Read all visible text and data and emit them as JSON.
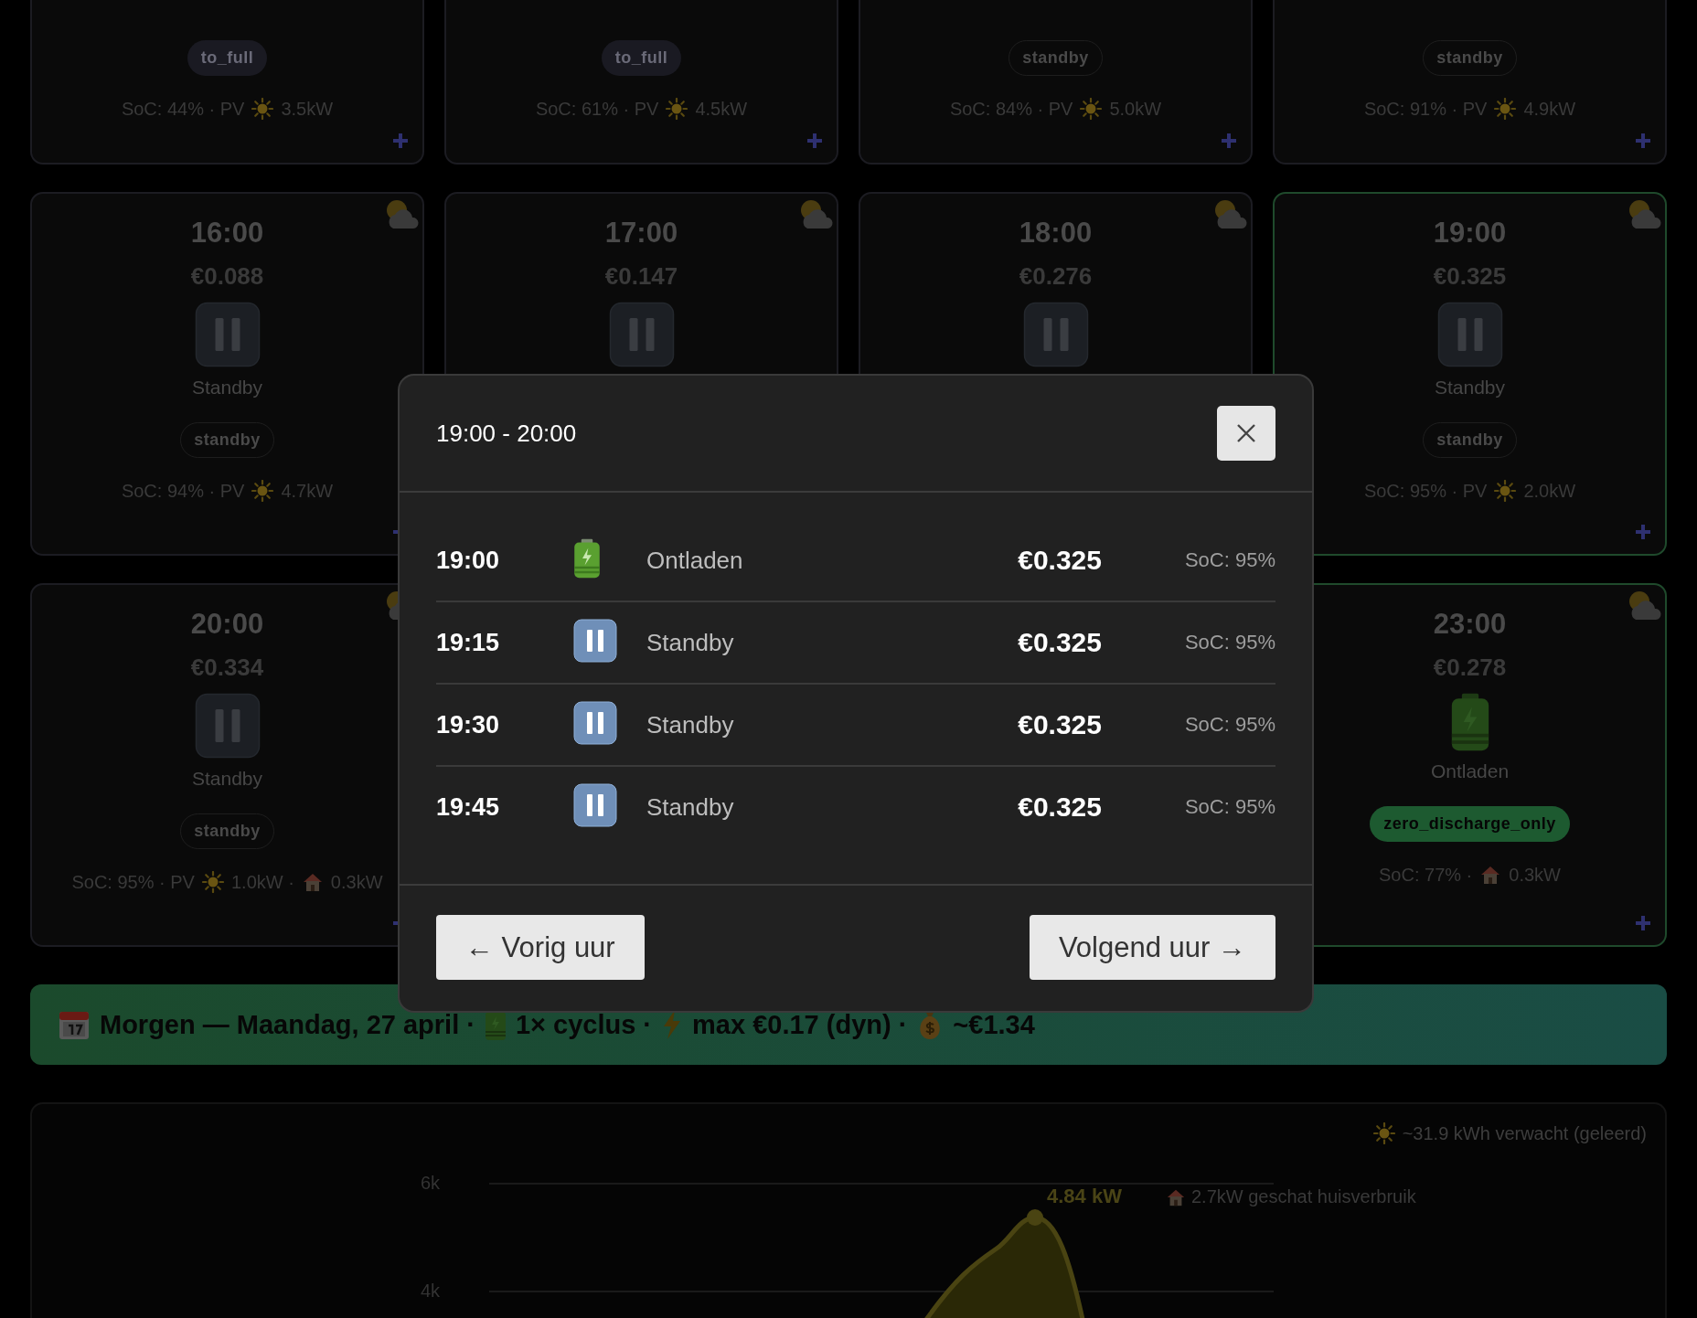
{
  "card_rows": [
    {
      "cards": [
        {
          "highlighted": false,
          "badge": {
            "text": "to_full",
            "kind": "dark"
          },
          "stats": [
            {
              "kind": "text",
              "text": "SoC: 44% · PV"
            },
            {
              "kind": "sun"
            },
            {
              "kind": "text",
              "text": "3.5kW"
            }
          ]
        },
        {
          "highlighted": false,
          "badge": {
            "text": "to_full",
            "kind": "dark"
          },
          "stats": [
            {
              "kind": "text",
              "text": "SoC: 61% · PV"
            },
            {
              "kind": "sun"
            },
            {
              "kind": "text",
              "text": "4.5kW"
            }
          ]
        },
        {
          "highlighted": false,
          "badge": {
            "text": "standby",
            "kind": "outline"
          },
          "stats": [
            {
              "kind": "text",
              "text": "SoC: 84% · PV"
            },
            {
              "kind": "sun"
            },
            {
              "kind": "text",
              "text": "5.0kW"
            }
          ]
        },
        {
          "highlighted": false,
          "badge": {
            "text": "standby",
            "kind": "outline"
          },
          "stats": [
            {
              "kind": "text",
              "text": "SoC: 91% · PV"
            },
            {
              "kind": "sun"
            },
            {
              "kind": "text",
              "text": "4.9kW"
            }
          ]
        }
      ]
    },
    {
      "cards": [
        {
          "time": "16:00",
          "price": "€0.088",
          "kind": "standby",
          "label": "Standby",
          "highlighted": false,
          "badge": {
            "text": "standby",
            "kind": "outline"
          },
          "stats": [
            {
              "kind": "text",
              "text": "SoC: 94% · PV"
            },
            {
              "kind": "sun"
            },
            {
              "kind": "text",
              "text": "4.7kW"
            }
          ]
        },
        {
          "time": "17:00",
          "price": "€0.147",
          "kind": "standby",
          "highlighted": false
        },
        {
          "time": "18:00",
          "price": "€0.276",
          "kind": "standby",
          "highlighted": false
        },
        {
          "time": "19:00",
          "price": "€0.325",
          "kind": "standby",
          "label": "Standby",
          "highlighted": true,
          "badge": {
            "text": "standby",
            "kind": "outline"
          },
          "stats": [
            {
              "kind": "text",
              "text": "SoC: 95% · PV"
            },
            {
              "kind": "sun"
            },
            {
              "kind": "text",
              "text": "2.0kW"
            }
          ]
        }
      ]
    },
    {
      "cards": [
        {
          "time": "20:00",
          "price": "€0.334",
          "kind": "standby",
          "label": "Standby",
          "highlighted": false,
          "badge": {
            "text": "standby",
            "kind": "outline"
          },
          "stats": [
            {
              "kind": "text",
              "text": "SoC: 95% · PV"
            },
            {
              "kind": "sun"
            },
            {
              "kind": "text",
              "text": "1.0kW ·"
            },
            {
              "kind": "house"
            },
            {
              "kind": "text",
              "text": "0.3kW"
            }
          ]
        },
        {
          "time": "23:00",
          "price": "€0.278",
          "kind": "discharge",
          "label": "Ontladen",
          "highlighted": true,
          "badge": {
            "text": "zero_discharge_only",
            "kind": "green"
          },
          "stats": [
            {
              "kind": "text",
              "text": "SoC: 77% ·"
            },
            {
              "kind": "house"
            },
            {
              "kind": "text",
              "text": "0.3kW"
            }
          ]
        }
      ]
    }
  ],
  "banner": [
    {
      "kind": "calendar"
    },
    {
      "kind": "text",
      "text": "Morgen — Maandag, 27 april ·"
    },
    {
      "kind": "battery"
    },
    {
      "kind": "text",
      "text": "1× cyclus ·"
    },
    {
      "kind": "lightning"
    },
    {
      "kind": "text",
      "text": "max €0.17 (dyn) ·"
    },
    {
      "kind": "money"
    },
    {
      "kind": "text",
      "text": "~€1.34"
    }
  ],
  "chart": {
    "forecast": "~31.9 kWh verwacht (geleerd)",
    "yticks": [
      "6k",
      "4k"
    ],
    "peak_label": "4.84 kW",
    "house_label": "2.7kW geschat huisverbruik"
  },
  "modal": {
    "title": "19:00 - 20:00",
    "rows": [
      {
        "time": "19:00",
        "kind": "discharge",
        "label": "Ontladen",
        "price": "€0.325",
        "soc": "SoC: 95%"
      },
      {
        "time": "19:15",
        "kind": "standby",
        "label": "Standby",
        "price": "€0.325",
        "soc": "SoC: 95%"
      },
      {
        "time": "19:30",
        "kind": "standby",
        "label": "Standby",
        "price": "€0.325",
        "soc": "SoC: 95%"
      },
      {
        "time": "19:45",
        "kind": "standby",
        "label": "Standby",
        "price": "€0.325",
        "soc": "SoC: 95%"
      }
    ],
    "prev": "← Vorig uur",
    "next": "Volgend uur →"
  }
}
